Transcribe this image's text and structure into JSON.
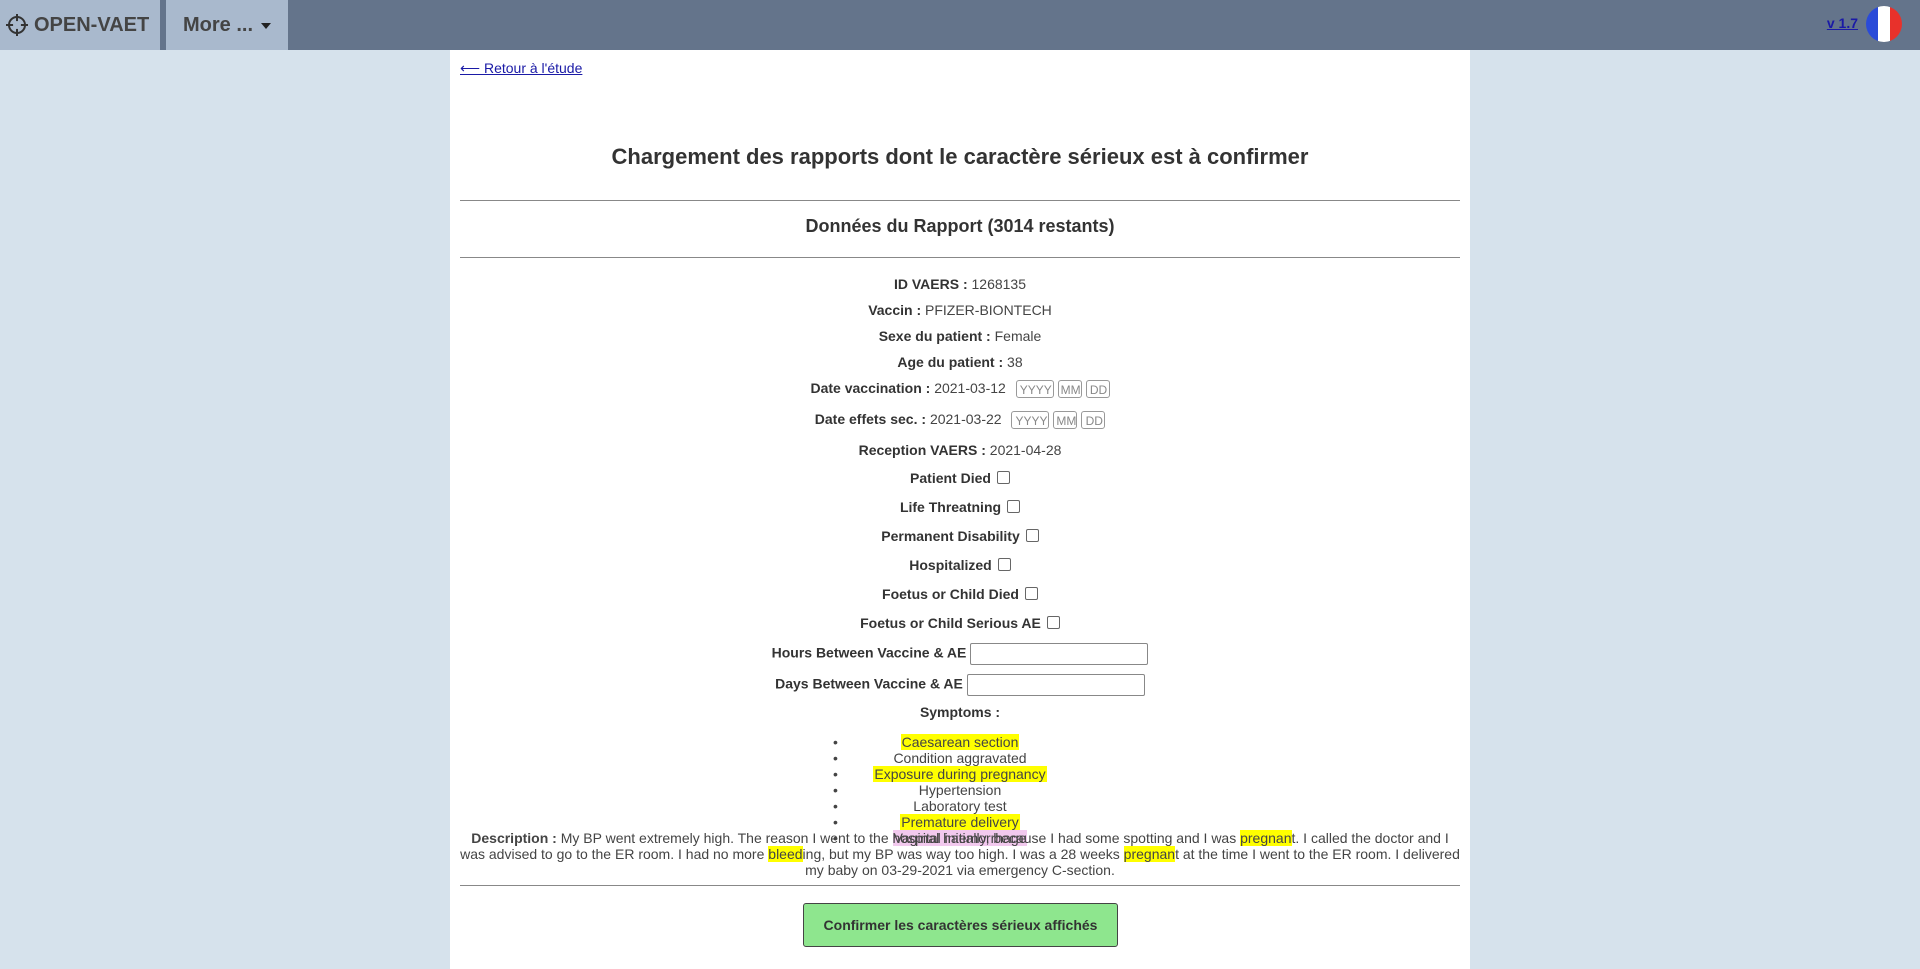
{
  "nav": {
    "brand": "OPEN-VAET",
    "more_label": "More ...",
    "version": "v 1.7",
    "flag_colors": [
      "#2a4bd8",
      "#ffffff",
      "#e8312b"
    ]
  },
  "page": {
    "back_link": "⟵ Retour à l'étude",
    "title": "Chargement des rapports dont le caractère sérieux est à confirmer",
    "subtitle": "Données du Rapport (3014 restants)"
  },
  "report": {
    "id_label": "ID VAERS :",
    "id_value": "1268135",
    "vaccine_label": "Vaccin :",
    "vaccine_value": "PFIZER-BIONTECH",
    "sex_label": "Sexe du patient :",
    "sex_value": "Female",
    "age_label": "Age du patient :",
    "age_value": "38",
    "vacc_date_label": "Date vaccination :",
    "vacc_date_value": "2021-03-12",
    "ae_date_label": "Date effets sec. :",
    "ae_date_value": "2021-03-22",
    "reception_label": "Reception VAERS :",
    "reception_value": "2021-04-28",
    "date_placeholders": {
      "year": "YYYY",
      "month": "MM",
      "day": "DD"
    }
  },
  "checkboxes": [
    {
      "label": "Patient Died"
    },
    {
      "label": "Life Threatning"
    },
    {
      "label": "Permanent Disability"
    },
    {
      "label": "Hospitalized"
    },
    {
      "label": "Foetus or Child Died"
    },
    {
      "label": "Foetus or Child Serious AE"
    }
  ],
  "inputs": {
    "hours_label": "Hours Between Vaccine & AE",
    "days_label": "Days Between Vaccine & AE"
  },
  "symptoms_label": "Symptoms :",
  "symptoms": [
    {
      "text": "Caesarean section",
      "highlight": "yellow"
    },
    {
      "text": "Condition aggravated",
      "highlight": "none"
    },
    {
      "text": "Exposure during pregnancy",
      "highlight": "yellow"
    },
    {
      "text": "Hypertension",
      "highlight": "none"
    },
    {
      "text": "Laboratory test",
      "highlight": "none"
    },
    {
      "text": "Premature delivery",
      "highlight": "yellow"
    },
    {
      "text": "Vaginal haemorrhage",
      "highlight": "pink"
    }
  ],
  "description": {
    "label": "Description :",
    "p1": " My BP went extremely high. The reason I went to the hospital initially, because I had some spotting and I was ",
    "h1": "pregnan",
    "p2": "t. I called the doctor and I was advised to go to the ER room. I had no more ",
    "h2": "bleed",
    "p3": "ing, but my BP was way too high. I was a 28 weeks ",
    "h3": "pregnan",
    "p4": "t at the time I went to the ER room. I delivered my baby on 03-29-2021 via emergency C-section."
  },
  "confirm_label": "Confirmer les caractères sérieux affichés"
}
